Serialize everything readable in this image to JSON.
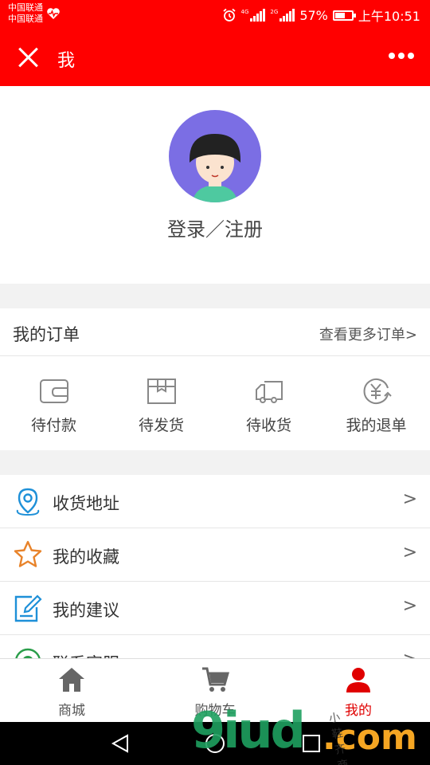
{
  "status_bar": {
    "carrier1": "中国联通",
    "carrier2": "中国联通",
    "net1": "4G",
    "net2": "2G",
    "battery_percent": "57%",
    "battery_level": 0.57,
    "time": "上午10:51"
  },
  "header": {
    "title": "我",
    "accent_color": "#ff0000"
  },
  "profile": {
    "login_label": "登录／注册"
  },
  "orders": {
    "title": "我的订单",
    "more_label": "查看更多订单>",
    "items": [
      {
        "label": "待付款",
        "icon": "wallet-icon"
      },
      {
        "label": "待发货",
        "icon": "box-icon"
      },
      {
        "label": "待收货",
        "icon": "truck-icon"
      },
      {
        "label": "我的退单",
        "icon": "yen-refund-icon"
      }
    ]
  },
  "menu": {
    "items": [
      {
        "label": "收货地址",
        "arrow": ">",
        "icon": "location-pin-icon",
        "color": "#1e90d8"
      },
      {
        "label": "我的收藏",
        "arrow": ">",
        "icon": "star-icon",
        "color": "#e8832a"
      },
      {
        "label": "我的建议",
        "arrow": ">",
        "icon": "edit-icon",
        "color": "#1e90d8"
      },
      {
        "label": "联系客服",
        "arrow": ">",
        "icon": "service-icon",
        "color": "#2a9d4a"
      }
    ]
  },
  "tabbar": {
    "items": [
      {
        "label": "商城",
        "icon": "home-icon"
      },
      {
        "label": "购物车",
        "icon": "cart-icon"
      },
      {
        "label": "我的",
        "icon": "user-icon",
        "active": true
      }
    ],
    "active_color": "#e00000"
  },
  "watermark": {
    "main": "9iud",
    "suffix": ".com",
    "small": "小鞋齐商店"
  }
}
